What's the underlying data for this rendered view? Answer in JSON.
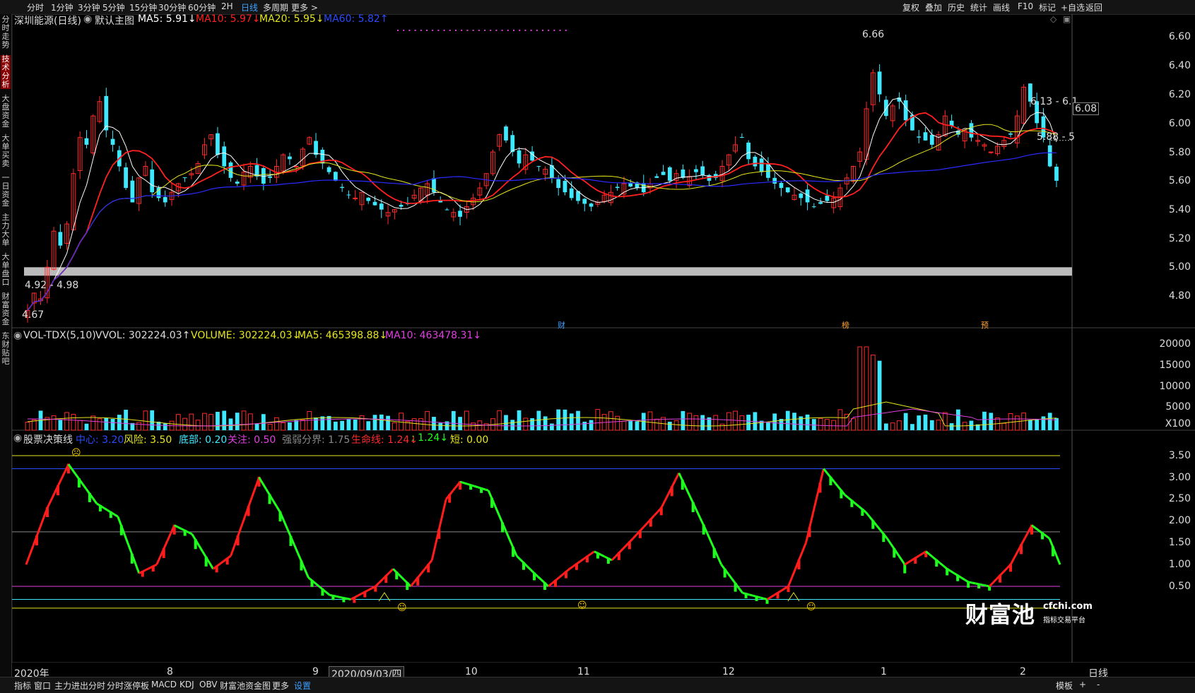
{
  "toolbar": {
    "left": [
      "分时",
      "1分钟",
      "3分钟",
      "5分钟",
      "15分钟",
      "30分钟",
      "60分钟",
      "2H",
      "日线",
      "多周期",
      "更多 >"
    ],
    "active_index": 8,
    "right": [
      "复权",
      "叠加",
      "历史",
      "统计",
      "画线",
      "F10",
      "标记",
      "+自选",
      "返回"
    ]
  },
  "leftbar": [
    "分时走势",
    "技术分析",
    "大盘资金",
    "大单买卖",
    "一日资金",
    "主力大单",
    "大单盘口",
    "财富资金",
    "东财贴吧"
  ],
  "leftbar_active": 1,
  "main_header": {
    "stock": "深圳能源(日线)",
    "theme": "默认主图",
    "ma5": "MA5: 5.91↓",
    "ma10": "MA10: 5.97↓",
    "ma20": "MA20: 5.95↓",
    "ma60": "MA60: 5.82↑"
  },
  "vol_header": {
    "name": "VOL-TDX(5,10)",
    "vvol": "VVOL: 302224.03↑",
    "volume": "VOLUME: 302224.03↓",
    "ma5": "MA5: 465398.88↓",
    "ma10": "MA10: 463478.31↓"
  },
  "ind_header": {
    "name": "股票决策线",
    "center": "中心: 3.20",
    "risk": "风险: 3.50",
    "bottom": "底部: 0.20",
    "focus": "关注: 0.50",
    "strength": "强弱分界: 1.75",
    "life": "生命线: 1.24↓",
    "colon": ": 1.24↓",
    "short": "短: 0.00"
  },
  "price_axis": [
    "6.60",
    "6.40",
    "6.20",
    "6.00",
    "5.80",
    "5.60",
    "5.40",
    "5.20",
    "5.00",
    "4.80"
  ],
  "vol_axis": [
    "20000",
    "15000",
    "10000",
    "5000",
    "X100"
  ],
  "ind_axis": [
    "3.50",
    "3.00",
    "2.50",
    "2.00",
    "1.50",
    "1.00",
    "0.50"
  ],
  "price_labels": {
    "high": "6.66",
    "low": "4.67",
    "box": "4.92 - 4.98",
    "r1": "6.13 - 6.1",
    "r2": "5.88 - 5",
    "current": "6.08"
  },
  "event_marks": [
    "财",
    "榜",
    "预"
  ],
  "x_labels": [
    "2020年",
    "8",
    "9",
    "2020/09/03/四",
    "10",
    "11",
    "12",
    "1",
    "2"
  ],
  "period_label": "日线",
  "bottom_bar": {
    "left": [
      "指标",
      "窗口",
      "主力进出分时",
      "分时涨停板",
      "MACD",
      "KDJ",
      "OBV",
      "财富池资金图",
      "更多",
      "设置"
    ],
    "active_index": 9,
    "right": [
      "模板",
      "+",
      "-"
    ]
  },
  "watermark": {
    "brand": "财富池",
    "domain": "cfchi.com",
    "slogan": "指标交易平台"
  },
  "colors": {
    "up": "#ff2a2a",
    "down": "#3ee8ff",
    "ma5": "#ffffff",
    "ma10": "#ff2020",
    "ma20": "#e6e61e",
    "ma60": "#2a2aff",
    "rise": "#ff1c1c",
    "fall": "#1eff1e"
  },
  "chart_data": {
    "type": "candlestick",
    "price_range": [
      4.65,
      6.7
    ],
    "candles_close": [
      4.7,
      4.82,
      4.78,
      5.0,
      5.25,
      5.15,
      5.3,
      5.65,
      5.9,
      5.85,
      6.05,
      6.15,
      5.95,
      5.85,
      5.7,
      5.55,
      5.45,
      5.62,
      5.7,
      5.52,
      5.48,
      5.45,
      5.52,
      5.58,
      5.62,
      5.65,
      5.72,
      5.85,
      5.92,
      5.78,
      5.7,
      5.62,
      5.58,
      5.66,
      5.7,
      5.63,
      5.58,
      5.62,
      5.7,
      5.78,
      5.75,
      5.7,
      5.82,
      5.9,
      5.78,
      5.72,
      5.66,
      5.6,
      5.55,
      5.5,
      5.48,
      5.52,
      5.46,
      5.43,
      5.4,
      5.38,
      5.4,
      5.42,
      5.44,
      5.5,
      5.55,
      5.58,
      5.52,
      5.45,
      5.4,
      5.38,
      5.35,
      5.42,
      5.48,
      5.55,
      5.65,
      5.8,
      5.92,
      5.88,
      5.8,
      5.72,
      5.78,
      5.74,
      5.7,
      5.68,
      5.62,
      5.55,
      5.52,
      5.48,
      5.46,
      5.44,
      5.42,
      5.45,
      5.5,
      5.52,
      5.55,
      5.58,
      5.56,
      5.55,
      5.52,
      5.58,
      5.62,
      5.64,
      5.6,
      5.65,
      5.62,
      5.63,
      5.66,
      5.64,
      5.6,
      5.62,
      5.7,
      5.78,
      5.85,
      5.9,
      5.75,
      5.7,
      5.66,
      5.62,
      5.58,
      5.55,
      5.52,
      5.5,
      5.48,
      5.45,
      5.42,
      5.44,
      5.46,
      5.48,
      5.55,
      5.62,
      5.7,
      5.8,
      6.1,
      6.35,
      6.2,
      6.05,
      6.12,
      6.15,
      6.02,
      5.95,
      5.9,
      5.88,
      5.85,
      5.92,
      6.05,
      5.98,
      5.92,
      5.95,
      5.9,
      5.88,
      5.85,
      5.8,
      5.84,
      5.88,
      5.92,
      6.05,
      6.25,
      6.15,
      6.0,
      5.9,
      5.7,
      5.6
    ],
    "ma5_range": [
      4.7,
      6.35
    ],
    "ma60_range": [
      4.9,
      5.82
    ]
  }
}
